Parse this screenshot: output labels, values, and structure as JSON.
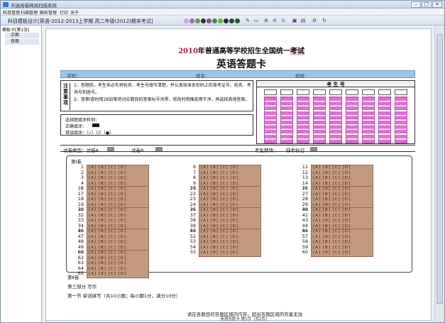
{
  "window": {
    "title": "天迷阅卷网阅扫描系统",
    "menu": [
      "科目管理",
      "扫描管理",
      "解析管理",
      "打印",
      "关于"
    ]
  },
  "toolbar": {
    "breadcrumb": "科目模板设计[英语-2012-2013上学期 高二年级(2012)期末考试]",
    "dot_colors": [
      "#d9a3d6",
      "#9a6ec9",
      "#6b9a3c",
      "#2f2f2f",
      "#8a4f8f",
      "#4c8a3e",
      "#6fb050",
      "#2c2c2c",
      "#3c3c3c",
      "#1f5b1f"
    ]
  },
  "sidebar": {
    "root": "模板卡[第1张]",
    "items": [
      "正面",
      "背面"
    ]
  },
  "sheet": {
    "title_year": "2010",
    "title_mid": "年普通高等学校招生全国统一",
    "title_end": "考试",
    "subtitle": "英语答题卡",
    "school_label": "学校：",
    "name_label": "姓名：",
    "class_label": "班级：",
    "notice_label": "注意事项",
    "notices": [
      "1、答题前，考生务必先将姓名、考生号填写清楚，并认真核准条形码上的准考证号、姓名、考场号和座号。",
      "2、答第Ⅰ卷时用2B铅笔将对应题目的答案标号涂黑，修改时用橡皮擦干净，再选择其他答案。"
    ],
    "fill_title": "选择题填涂样例：",
    "fill_right": "正确填涂：",
    "fill_wrong": "错误填涂：〔√〕〔/〕〔●〕",
    "id_header": "考 生 号",
    "type_label": "试卷类型：试卷A",
    "type_b": "试卷B",
    "forbid_label": "考生禁填：",
    "missing_label": "缺考标记",
    "part1_title": "第Ⅰ卷",
    "choice_row": "[A] [B] [C] [D]",
    "q_nums": [
      [
        1,
        2,
        3,
        4,
        5
      ],
      [
        6,
        7,
        8,
        9,
        10
      ],
      [
        11,
        12,
        13,
        14,
        15
      ],
      [
        16,
        17,
        18,
        19,
        20
      ],
      [
        21,
        22,
        23,
        24,
        25
      ],
      [
        26,
        27,
        28,
        29,
        30
      ],
      [
        31,
        32,
        33,
        34,
        35
      ],
      [
        36,
        37,
        38,
        39,
        40
      ],
      [
        41,
        42,
        43,
        44,
        45
      ],
      [
        46,
        47,
        48,
        49,
        50
      ],
      [
        51,
        52,
        53,
        54,
        55
      ],
      [
        56,
        57,
        58,
        59,
        60
      ],
      [
        61,
        62,
        63,
        64,
        65
      ]
    ],
    "part2_title": "第Ⅱ卷",
    "part2_sec": "第三部分  写作",
    "part2_sub": "第一节  单词拼写（共10小题；每小题1分，满分10分）",
    "footer": "请在各题目的答题区域内作答，超出答题区域的答案无效",
    "page_info": "英语答题卡  第1页（共2页）"
  }
}
